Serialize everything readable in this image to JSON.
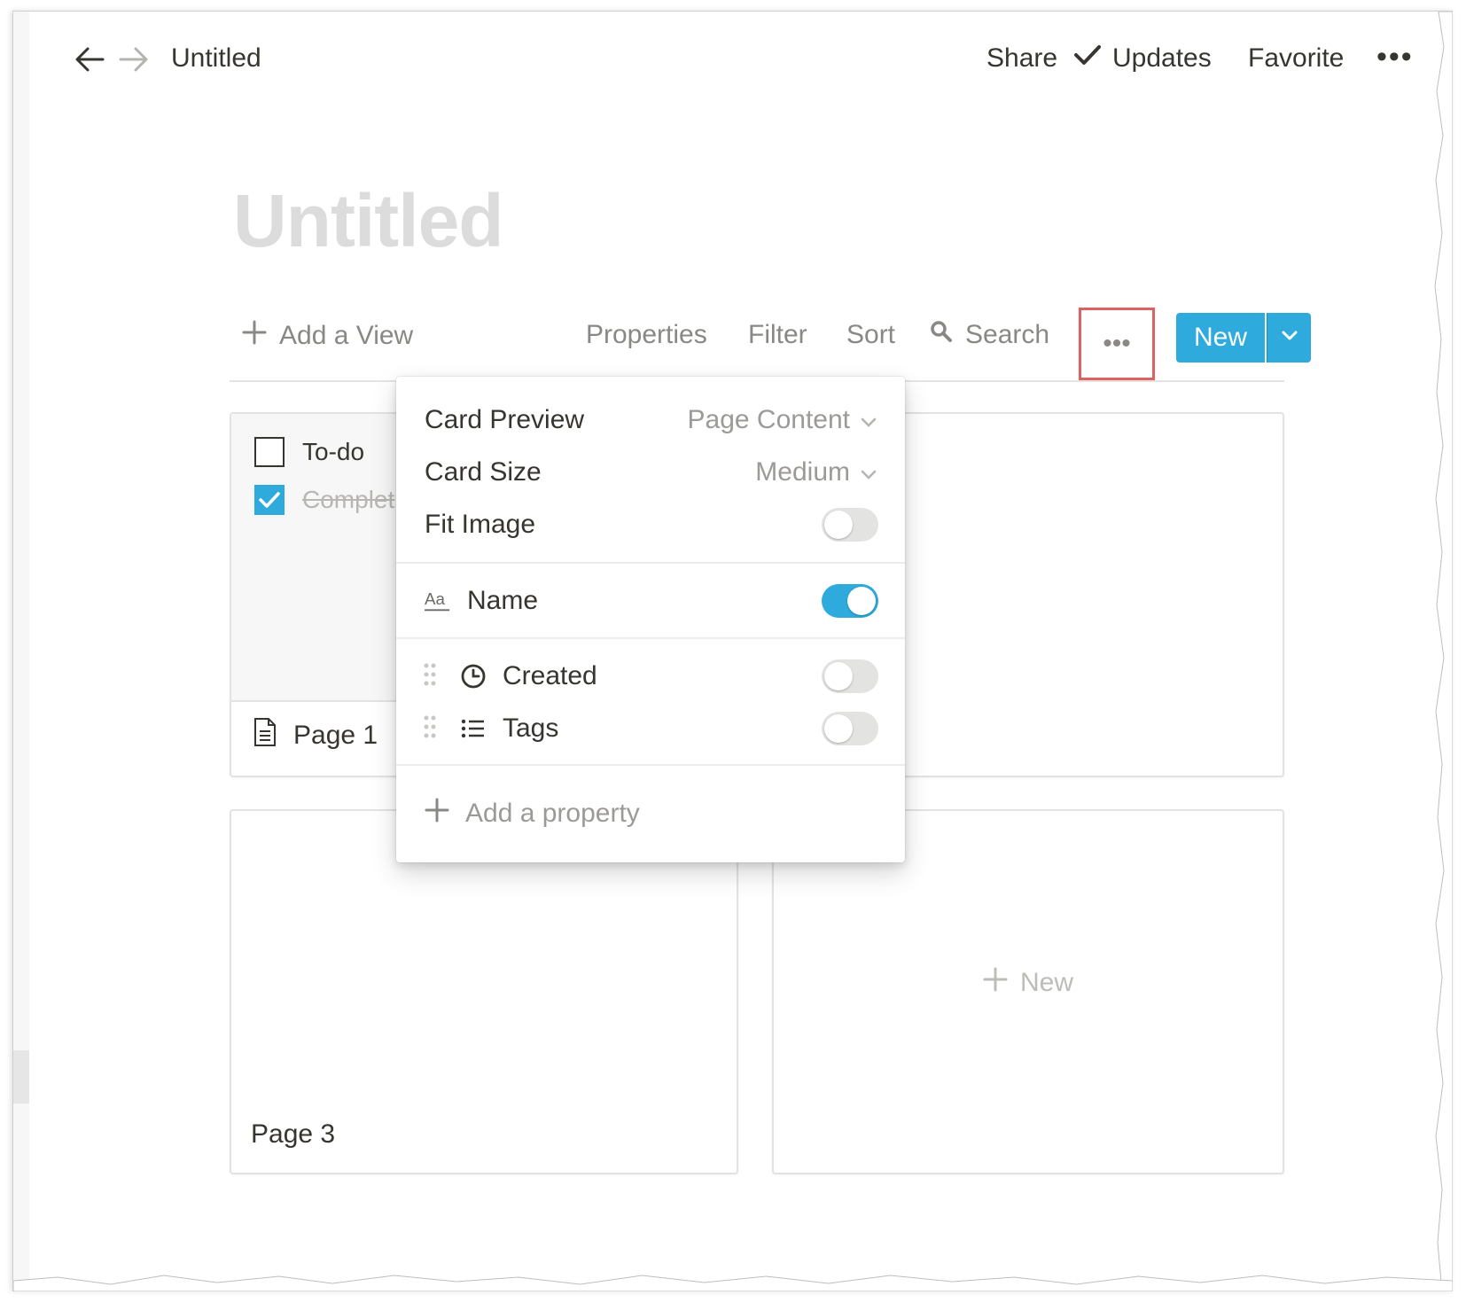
{
  "topbar": {
    "breadcrumb": "Untitled",
    "share_label": "Share",
    "updates_label": "Updates",
    "favorite_label": "Favorite",
    "more_label": "•••"
  },
  "page": {
    "title": "Untitled"
  },
  "toolbar": {
    "add_view_label": "Add a View",
    "properties_label": "Properties",
    "filter_label": "Filter",
    "sort_label": "Sort",
    "search_label": "Search",
    "more_label": "•••",
    "new_label": "New",
    "accent_color": "#2eaadc"
  },
  "cards": [
    {
      "title": "Page 1",
      "preview_items": [
        {
          "label": "To-do",
          "checked": false
        },
        {
          "label": "Complet",
          "checked": true
        }
      ]
    },
    {
      "title": ""
    },
    {
      "title": "Page 3"
    },
    {
      "add_new_label": "New"
    }
  ],
  "menu": {
    "card_preview_label": "Card Preview",
    "card_preview_value": "Page Content",
    "card_size_label": "Card Size",
    "card_size_value": "Medium",
    "fit_image_label": "Fit Image",
    "fit_image_on": false,
    "properties": [
      {
        "name": "Name",
        "icon": "text-aa-icon",
        "visible": true
      },
      {
        "name": "Created",
        "icon": "clock-icon",
        "visible": false
      },
      {
        "name": "Tags",
        "icon": "list-icon",
        "visible": false
      }
    ],
    "add_property_label": "Add a property"
  }
}
